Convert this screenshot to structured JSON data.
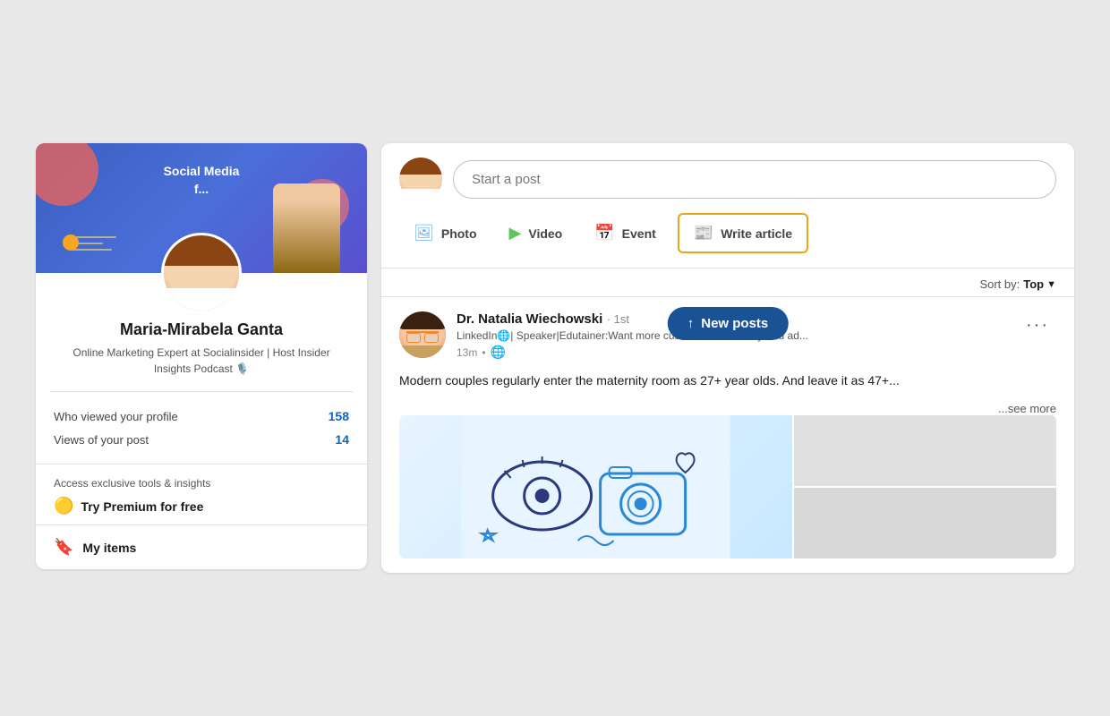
{
  "page": {
    "background_color": "#e8e8e8"
  },
  "left_panel": {
    "banner": {
      "text": "Social Media",
      "subtext": "f..."
    },
    "profile": {
      "name": "Maria-Mirabela Ganta",
      "title": "Online Marketing Expert at Socialinsider | Host Insider Insights Podcast 🎙️",
      "avatar_alt": "Profile photo of Maria-Mirabela Ganta"
    },
    "stats": {
      "label1": "Who viewed your profile",
      "value1": "158",
      "label2": "Views of your post",
      "value2": "14"
    },
    "premium": {
      "title": "Access exclusive tools & insights",
      "icon": "🟡",
      "cta": "Try Premium for free"
    },
    "my_items": {
      "icon": "🔖",
      "label": "My items"
    }
  },
  "right_panel": {
    "composer": {
      "placeholder": "Start a post",
      "actions": [
        {
          "id": "photo",
          "icon": "🖼️",
          "label": "Photo",
          "color": "#70b5f9"
        },
        {
          "id": "video",
          "icon": "▶️",
          "label": "Video",
          "color": "#5fc55e"
        },
        {
          "id": "event",
          "icon": "📅",
          "label": "Event",
          "color": "#e78b3e"
        }
      ],
      "write_article": {
        "icon": "📰",
        "label": "Write article"
      }
    },
    "feed": {
      "sort_label": "Sort by:",
      "sort_value": "Top",
      "new_posts_pill": "↑ New posts",
      "post": {
        "author_name": "Dr. Natalia Wiechowski",
        "author_badge": "· 1st",
        "author_desc": "LinkedIn🌐| Speaker|Edutainer:Want more customers & visibility thru ad...",
        "time": "13m",
        "globe_icon": "🌐",
        "content": "Modern couples regularly enter the maternity room as 27+ year olds. And leave it as 47+...",
        "see_more": "...see more",
        "more_btn": "···"
      }
    }
  }
}
